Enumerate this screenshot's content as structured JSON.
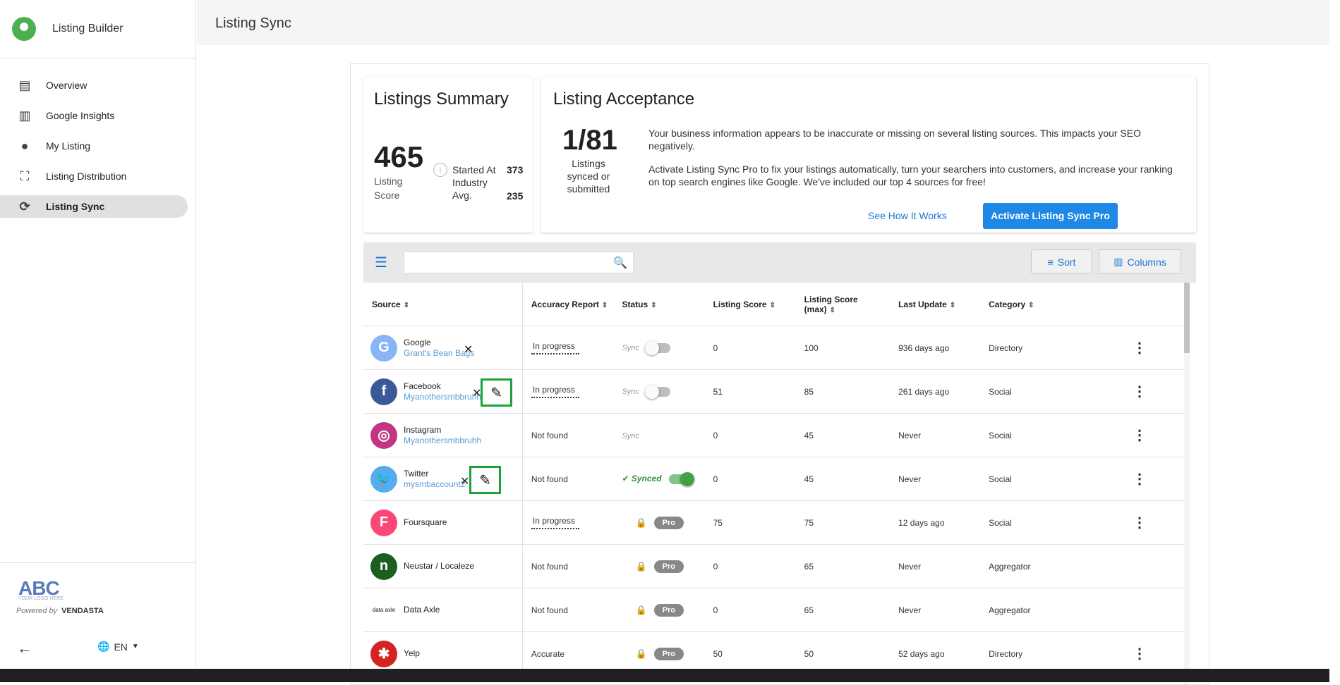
{
  "app": {
    "name": "Listing Builder"
  },
  "sidebar": {
    "items": [
      {
        "label": "Overview",
        "icon": "dashboard-icon"
      },
      {
        "label": "Google Insights",
        "icon": "bar-chart-icon"
      },
      {
        "label": "My Listing",
        "icon": "location-pin-icon"
      },
      {
        "label": "Listing Distribution",
        "icon": "expand-icon"
      },
      {
        "label": "Listing Sync",
        "icon": "sync-icon",
        "active": true
      }
    ],
    "footer": {
      "logo_text": "ABC",
      "logo_sub": "YOUR LOGO HERE",
      "powered_by": "Powered by",
      "powered_brand": "VENDASTA",
      "language": "EN"
    }
  },
  "header": {
    "title": "Listing Sync"
  },
  "summary": {
    "title": "Listings Summary",
    "score": "465",
    "score_label": "Listing Score",
    "started_label": "Started At",
    "started_value": "373",
    "industry_label": "Industry Avg.",
    "industry_value": "235"
  },
  "acceptance": {
    "title": "Listing Acceptance",
    "fraction": "1/81",
    "fraction_label": "Listings synced or submitted",
    "paragraph1": "Your business information appears to be inaccurate or missing on several listing sources. This impacts your SEO negatively.",
    "paragraph2": "Activate Listing Sync Pro to fix your listings automatically, turn your searchers into customers, and increase your ranking on top search engines like Google. We've included our top 4 sources for free!",
    "link_label": "See How It Works",
    "button_label": "Activate Listing Sync Pro"
  },
  "toolbar": {
    "search_placeholder": "",
    "sort_label": "Sort",
    "columns_label": "Columns"
  },
  "table": {
    "headers": [
      "Source",
      "Accuracy Report",
      "Status",
      "Listing Score",
      "Listing Score (max)",
      "Last Update",
      "Category"
    ],
    "sync_label": "Sync",
    "synced_label": "Synced",
    "pro_label": "Pro",
    "rows": [
      {
        "source": "Google",
        "account": "Grant's Bean Bags",
        "accuracy": "In progress",
        "status": "toggle-off",
        "score": "0",
        "max": "100",
        "updated": "936 days ago",
        "category": "Directory",
        "color": "#8ab4f8",
        "glyph": "G"
      },
      {
        "source": "Facebook",
        "account": "Myanothersmbbruhh",
        "accuracy": "In progress",
        "status": "toggle-off",
        "score": "51",
        "max": "85",
        "updated": "261 days ago",
        "category": "Social",
        "color": "#3b5998",
        "glyph": "f"
      },
      {
        "source": "Instagram",
        "account": "Myanothersmbbruhh",
        "accuracy": "Not found",
        "status": "sync-only",
        "score": "0",
        "max": "45",
        "updated": "Never",
        "category": "Social",
        "color": "#c13584",
        "glyph": "◎"
      },
      {
        "source": "Twitter",
        "account": "mysmbaccount2",
        "accuracy": "Not found",
        "status": "synced",
        "score": "0",
        "max": "45",
        "updated": "Never",
        "category": "Social",
        "color": "#55acee",
        "glyph": "🐦"
      },
      {
        "source": "Foursquare",
        "account": "",
        "accuracy": "In progress",
        "status": "pro",
        "score": "75",
        "max": "75",
        "updated": "12 days ago",
        "category": "Social",
        "color": "#f94877",
        "glyph": "F"
      },
      {
        "source": "Neustar / Localeze",
        "account": "",
        "accuracy": "Not found",
        "status": "pro",
        "score": "0",
        "max": "65",
        "updated": "Never",
        "category": "Aggregator",
        "color": "#1b5e20",
        "glyph": "n"
      },
      {
        "source": "Data Axle",
        "account": "",
        "accuracy": "Not found",
        "status": "pro",
        "score": "0",
        "max": "65",
        "updated": "Never",
        "category": "Aggregator",
        "color": "#ffffff",
        "glyph": "data axle"
      },
      {
        "source": "Yelp",
        "account": "",
        "accuracy": "Accurate",
        "status": "pro",
        "score": "50",
        "max": "50",
        "updated": "52 days ago",
        "category": "Directory",
        "color": "#d32323",
        "glyph": "✱"
      }
    ]
  }
}
